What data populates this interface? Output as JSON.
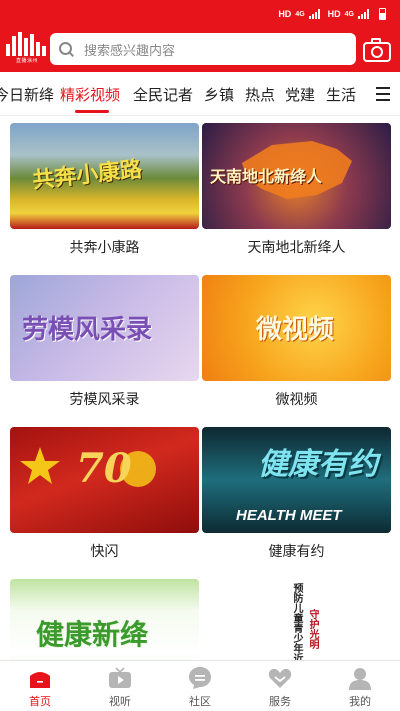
{
  "status": {
    "left_label": "HD",
    "net1": "4G",
    "right_label": "HD",
    "net2": "4G"
  },
  "header": {
    "search_placeholder": "搜索感兴趣内容",
    "logo_text": "直播涂州"
  },
  "tabs": [
    {
      "label": "今日新绛"
    },
    {
      "label": "精彩视频"
    },
    {
      "label": "全民记者"
    },
    {
      "label": "乡镇"
    },
    {
      "label": "热点"
    },
    {
      "label": "党建"
    },
    {
      "label": "生活"
    }
  ],
  "cards": [
    {
      "title": "共奔小康路",
      "thumb_text": "共奔小康路"
    },
    {
      "title": "天南地北新绛人",
      "thumb_text": "天南地北新绛人"
    },
    {
      "title": "劳模风采录",
      "thumb_text": "劳模风采录"
    },
    {
      "title": "微视频",
      "thumb_text": "微视频"
    },
    {
      "title": "快闪",
      "thumb_text": "70"
    },
    {
      "title": "健康有约",
      "thumb_text": "健康有约",
      "thumb_sub": "HEALTH MEET"
    },
    {
      "title": "",
      "thumb_text": "健康新绛"
    },
    {
      "title": "",
      "thumb_text": "预防儿童青少年近视",
      "thumb_sub": "守护光明"
    }
  ],
  "bottom_nav": [
    {
      "label": "首页"
    },
    {
      "label": "视听"
    },
    {
      "label": "社区"
    },
    {
      "label": "服务"
    },
    {
      "label": "我的"
    }
  ],
  "colors": {
    "brand": "#e8141b"
  }
}
